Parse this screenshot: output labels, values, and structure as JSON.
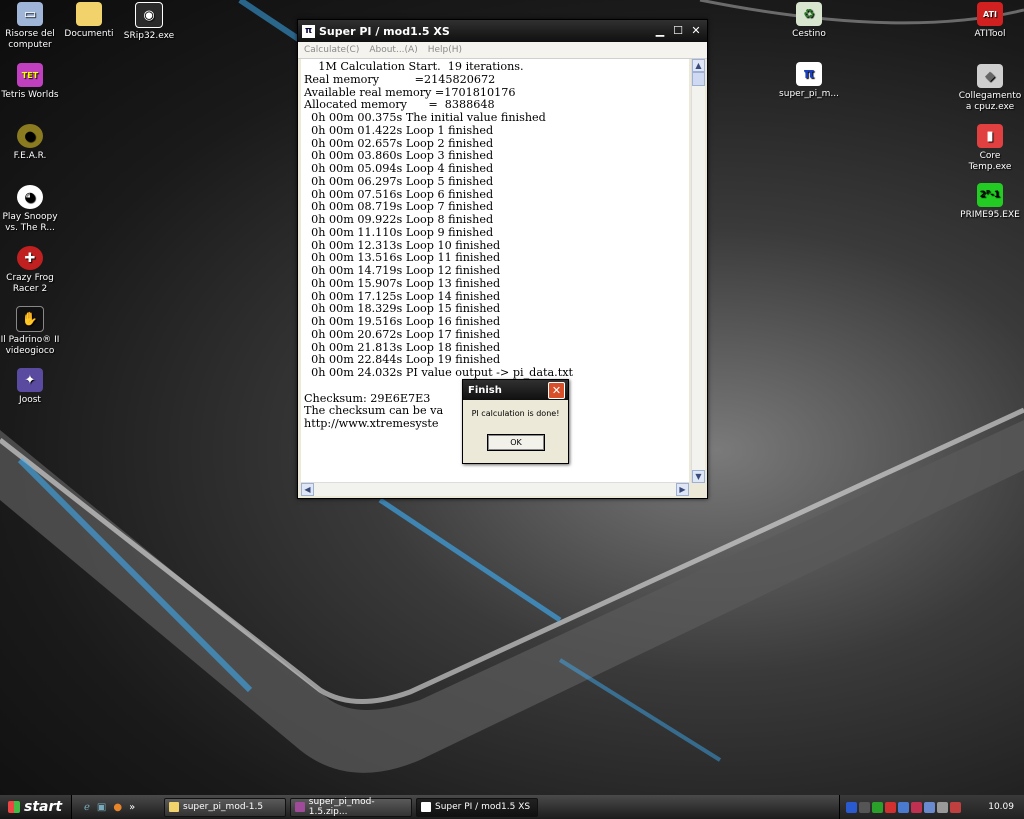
{
  "desktop": {
    "icons_left": [
      {
        "label": "Risorse del computer",
        "icon": "computer-icon",
        "color": "#9fb6d8"
      },
      {
        "label": "Documenti",
        "icon": "folder-icon",
        "color": "#f2d36b"
      },
      {
        "label": "SRip32.exe",
        "icon": "camera-icon",
        "color": "#2a2a2a"
      },
      {
        "label": "Tetris Worlds",
        "icon": "tetris-icon",
        "color": "#c040c0"
      },
      {
        "label": "F.E.A.R.",
        "icon": "eye-icon",
        "color": "#8a7a20"
      },
      {
        "label": "Play Snoopy vs. The R...",
        "icon": "snoopy-icon",
        "color": "#ffffff"
      },
      {
        "label": "Crazy Frog Racer 2",
        "icon": "frog-icon",
        "color": "#c02020"
      },
      {
        "label": "Il Padrino® II videogioco",
        "icon": "godfather-icon",
        "color": "#111111"
      },
      {
        "label": "Joost",
        "icon": "joost-icon",
        "color": "#5a4aa0"
      }
    ],
    "icons_right": [
      {
        "label": "Cestino",
        "icon": "recycle-bin-icon",
        "color": "#d8e6d0"
      },
      {
        "label": "super_pi_m...",
        "icon": "super-pi-icon",
        "color": "#ffffff"
      },
      {
        "label": "ATITool",
        "icon": "ati-icon",
        "color": "#d02020"
      },
      {
        "label": "Collegamento a cpuz.exe",
        "icon": "cpuz-icon",
        "color": "#cfcfcf"
      },
      {
        "label": "Core Temp.exe",
        "icon": "thermometer-icon",
        "color": "#e04040"
      },
      {
        "label": "PRIME95.EXE",
        "icon": "prime95-icon",
        "color": "#22cc22"
      }
    ]
  },
  "window": {
    "title": "Super PI / mod1.5 XS",
    "menu": [
      "Calculate(C)",
      "About...(A)",
      "Help(H)"
    ],
    "log": "    1M Calculation Start.  19 iterations.\nReal memory          =2145820672\nAvailable real memory =1701810176\nAllocated memory      =  8388648\n  0h 00m 00.375s The initial value finished\n  0h 00m 01.422s Loop 1 finished\n  0h 00m 02.657s Loop 2 finished\n  0h 00m 03.860s Loop 3 finished\n  0h 00m 05.094s Loop 4 finished\n  0h 00m 06.297s Loop 5 finished\n  0h 00m 07.516s Loop 6 finished\n  0h 00m 08.719s Loop 7 finished\n  0h 00m 09.922s Loop 8 finished\n  0h 00m 11.110s Loop 9 finished\n  0h 00m 12.313s Loop 10 finished\n  0h 00m 13.516s Loop 11 finished\n  0h 00m 14.719s Loop 12 finished\n  0h 00m 15.907s Loop 13 finished\n  0h 00m 17.125s Loop 14 finished\n  0h 00m 18.329s Loop 15 finished\n  0h 00m 19.516s Loop 16 finished\n  0h 00m 20.672s Loop 17 finished\n  0h 00m 21.813s Loop 18 finished\n  0h 00m 22.844s Loop 19 finished\n  0h 00m 24.032s PI value output -> pi_data.txt\n\nChecksum: 29E6E7E3\nThe checksum can be va\nhttp://www.xtremesyste"
  },
  "dialog": {
    "title": "Finish",
    "message": "PI calculation is done!",
    "ok_label": "OK"
  },
  "taskbar": {
    "start_label": "start",
    "tasks": [
      {
        "label": "super_pi_mod-1.5",
        "icon": "folder-icon",
        "color": "#f2d36b"
      },
      {
        "label": "super_pi_mod-1.5.zip...",
        "icon": "winrar-icon",
        "color": "#a04a9a"
      },
      {
        "label": "Super PI / mod1.5 XS",
        "icon": "super-pi-icon",
        "color": "#ffffff"
      }
    ],
    "clock": "10.09"
  }
}
